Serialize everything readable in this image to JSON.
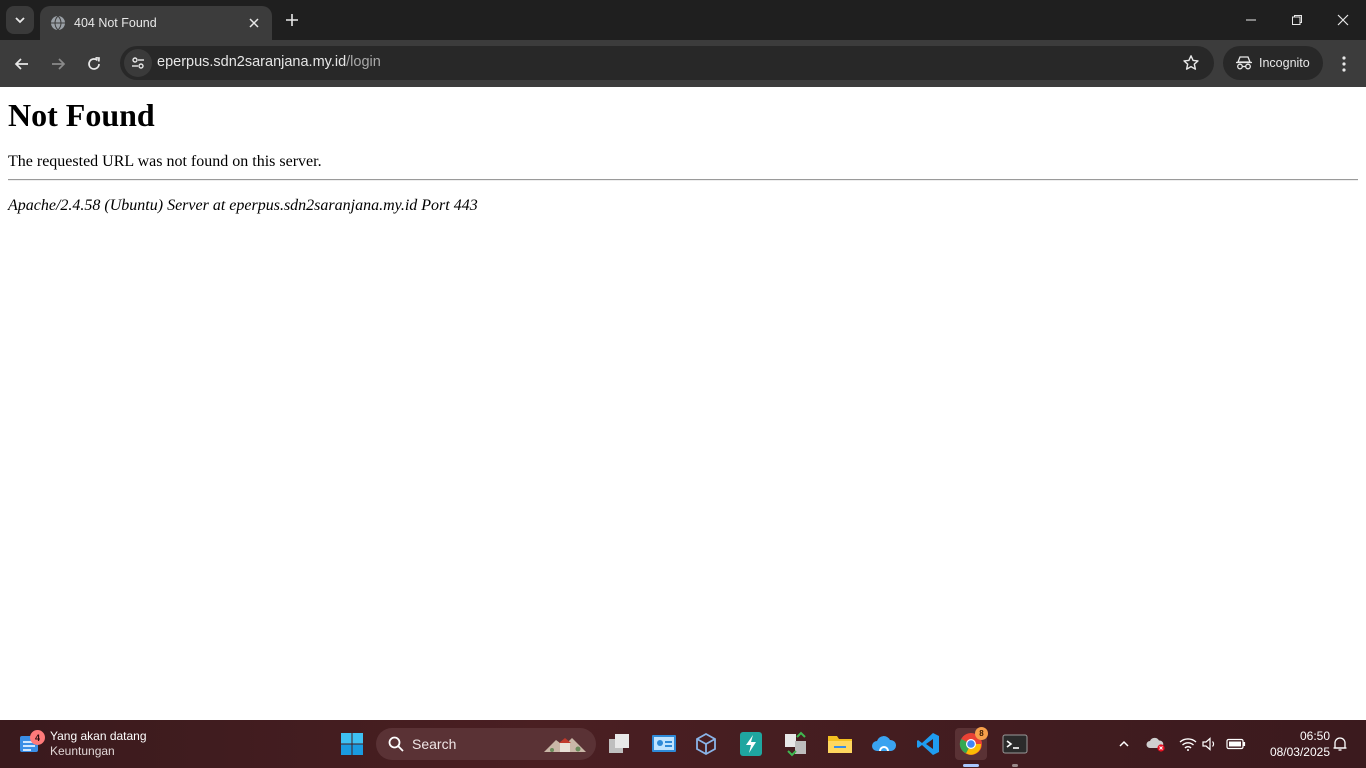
{
  "browser": {
    "tab": {
      "title": "404 Not Found"
    },
    "url": {
      "domain": "eperpus.sdn2saranjana.my.id",
      "path": "/login"
    },
    "incognito_label": "Incognito"
  },
  "page": {
    "heading": "Not Found",
    "message": "The requested URL was not found on this server.",
    "server_signature": "Apache/2.4.58 (Ubuntu) Server at eperpus.sdn2saranjana.my.id Port 443"
  },
  "taskbar": {
    "widget": {
      "badge": "4",
      "title": "Yang akan datang",
      "subtitle": "Keuntungan"
    },
    "search_label": "Search",
    "chrome_badge": "8",
    "clock": {
      "time": "06:50",
      "date": "08/03/2025"
    }
  },
  "colors": {
    "tab_strip": "#1f1f1f",
    "toolbar": "#3c3c3c",
    "omnibox": "#282828",
    "taskbar": "#3a1a1d"
  }
}
